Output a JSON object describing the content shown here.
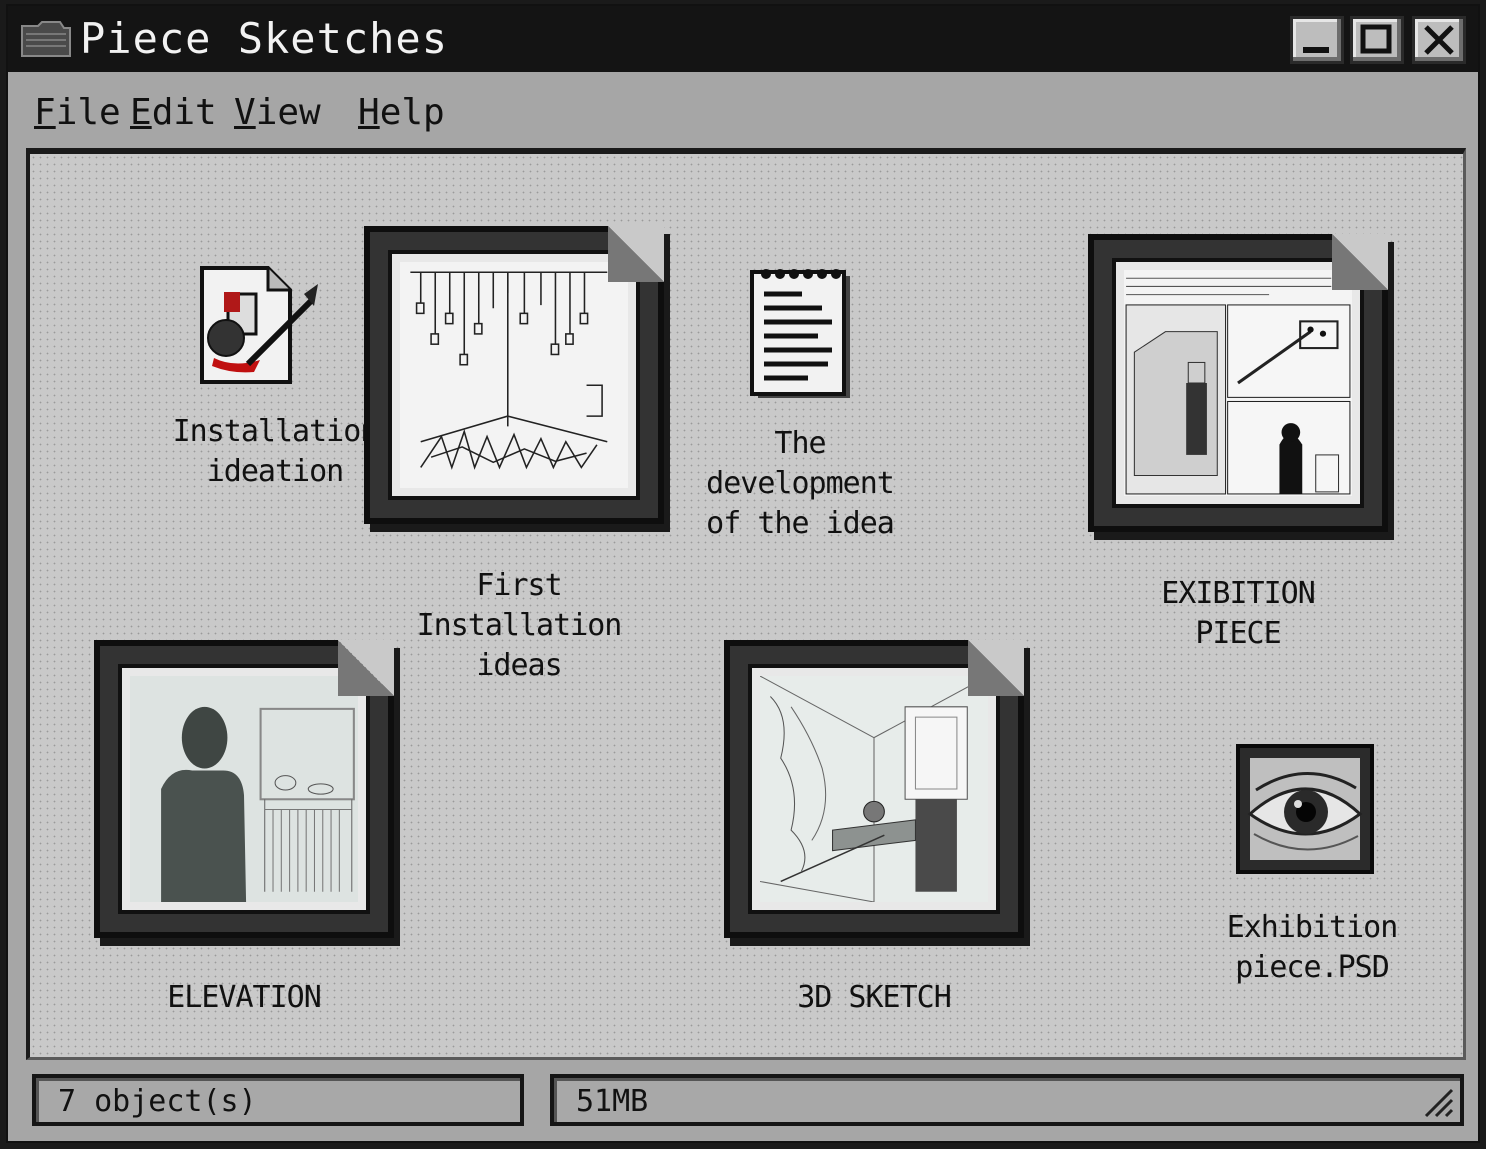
{
  "window": {
    "title": "Piece Sketches"
  },
  "menu": [
    "File",
    "Edit",
    "View",
    "Help"
  ],
  "icons": [
    {
      "label": "Installation ideation",
      "type": "paint-document-icon"
    },
    {
      "label": "First Installation ideas",
      "type": "image-thumbnail"
    },
    {
      "label": "The development of the idea",
      "type": "notepad-icon"
    },
    {
      "label": "EXIBITION PIECE",
      "type": "image-thumbnail"
    },
    {
      "label": "ELEVATION",
      "type": "image-thumbnail"
    },
    {
      "label": "3D SKETCH",
      "type": "image-thumbnail"
    },
    {
      "label": "Exhibition piece.PSD",
      "type": "eye-image-icon"
    }
  ],
  "status": {
    "objects": "7 object(s)",
    "size": "51MB"
  }
}
